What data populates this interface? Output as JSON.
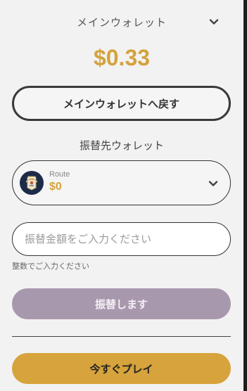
{
  "wallet": {
    "title": "メインウォレット",
    "balance": "$0.33",
    "back_label": "メインウォレットへ戻す"
  },
  "transfer": {
    "section_label": "振替先ウォレット",
    "target": {
      "name": "Route",
      "amount": "$0"
    },
    "amount_placeholder": "振替金額をご入力ください",
    "amount_value": "",
    "hint": "整数でご入力ください",
    "submit_label": "振替します"
  },
  "play": {
    "label": "今すぐプレイ"
  },
  "icons": {
    "wallet_dropdown": "chevron-down-icon",
    "target_dropdown": "chevron-down-icon",
    "target_logo": "route-logo-icon"
  },
  "colors": {
    "accent_gold": "#d4a23d",
    "submit_disabled": "#a898ad",
    "play_button": "#d6a33c",
    "border": "#333333"
  }
}
